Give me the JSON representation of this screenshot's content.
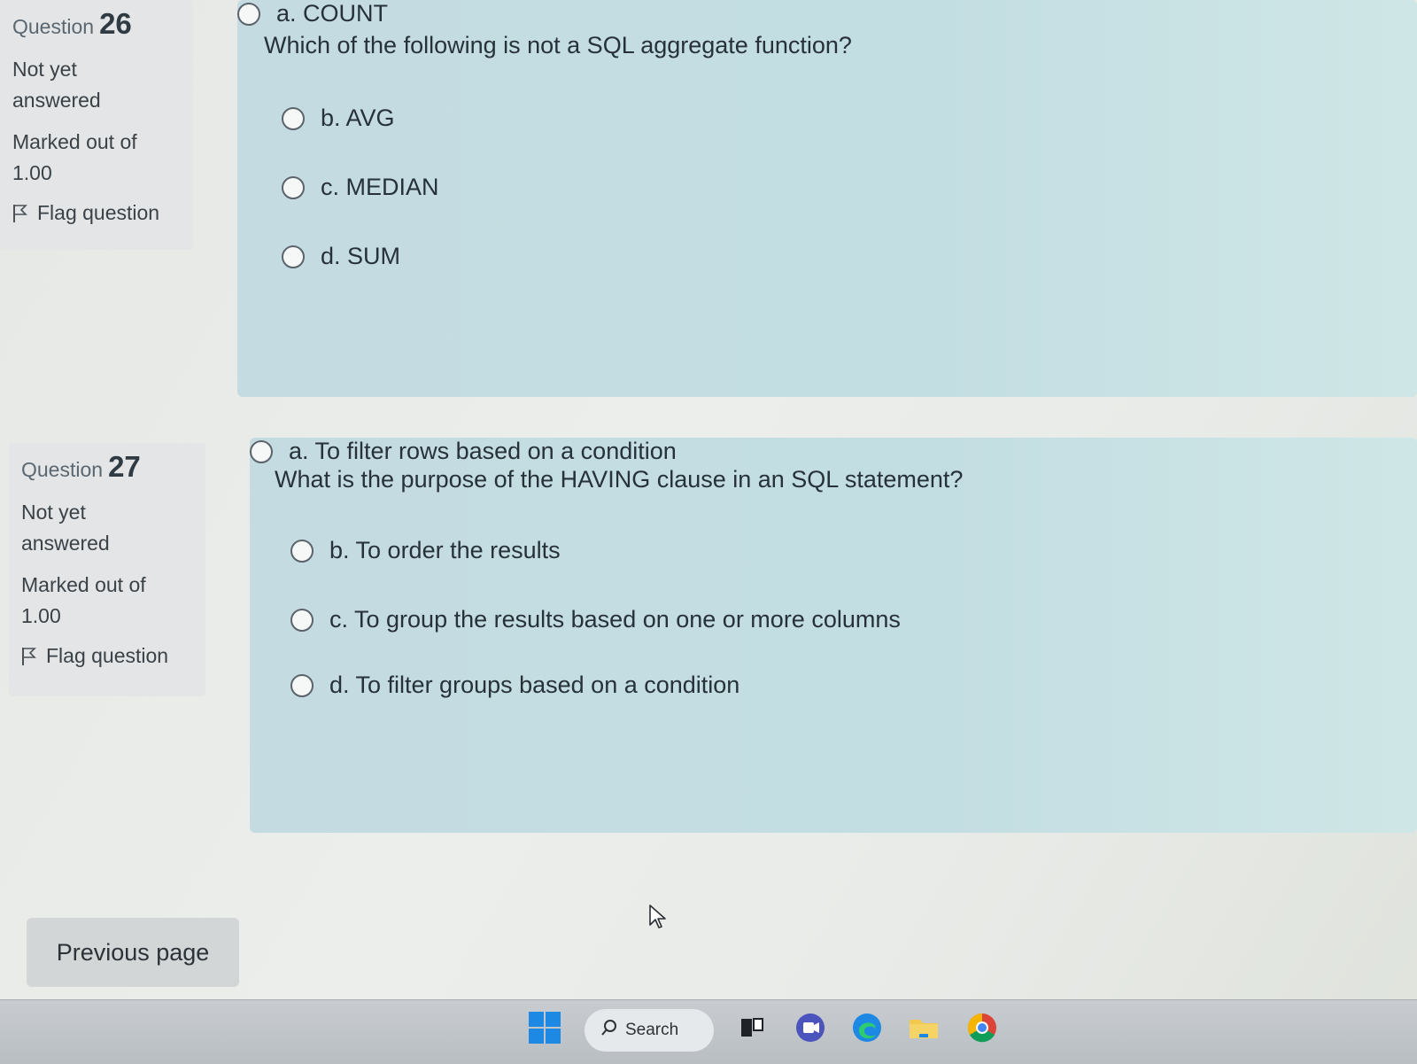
{
  "questions": [
    {
      "heading_label": "Question",
      "number": "26",
      "state": "Not yet answered",
      "grade": "Marked out of 1.00",
      "flag_label": "Flag question",
      "text": "Which of the following is not a SQL aggregate function?",
      "answers": [
        "a. COUNT",
        "b. AVG",
        "c. MEDIAN",
        "d. SUM"
      ]
    },
    {
      "heading_label": "Question",
      "number": "27",
      "state": "Not yet answered",
      "grade": "Marked out of 1.00",
      "flag_label": "Flag question",
      "text": "What is the purpose of the HAVING clause in an SQL statement?",
      "answers": [
        "a. To filter rows based on a condition",
        "b. To order the results",
        "c. To group the results based on one or more columns",
        "d. To filter groups based on a condition"
      ]
    }
  ],
  "navigation": {
    "previous_label": "Previous page"
  },
  "taskbar": {
    "search_label": "Search",
    "icons": [
      "windows-start-icon",
      "search-icon",
      "task-view-icon",
      "teams-icon",
      "edge-icon",
      "file-explorer-icon",
      "chrome-icon"
    ]
  },
  "colors": {
    "content_background": "#c4dce1",
    "info_background": "#e3e5e6",
    "page_background": "#e9ebe8",
    "windows_blue": "#1e88e5"
  }
}
